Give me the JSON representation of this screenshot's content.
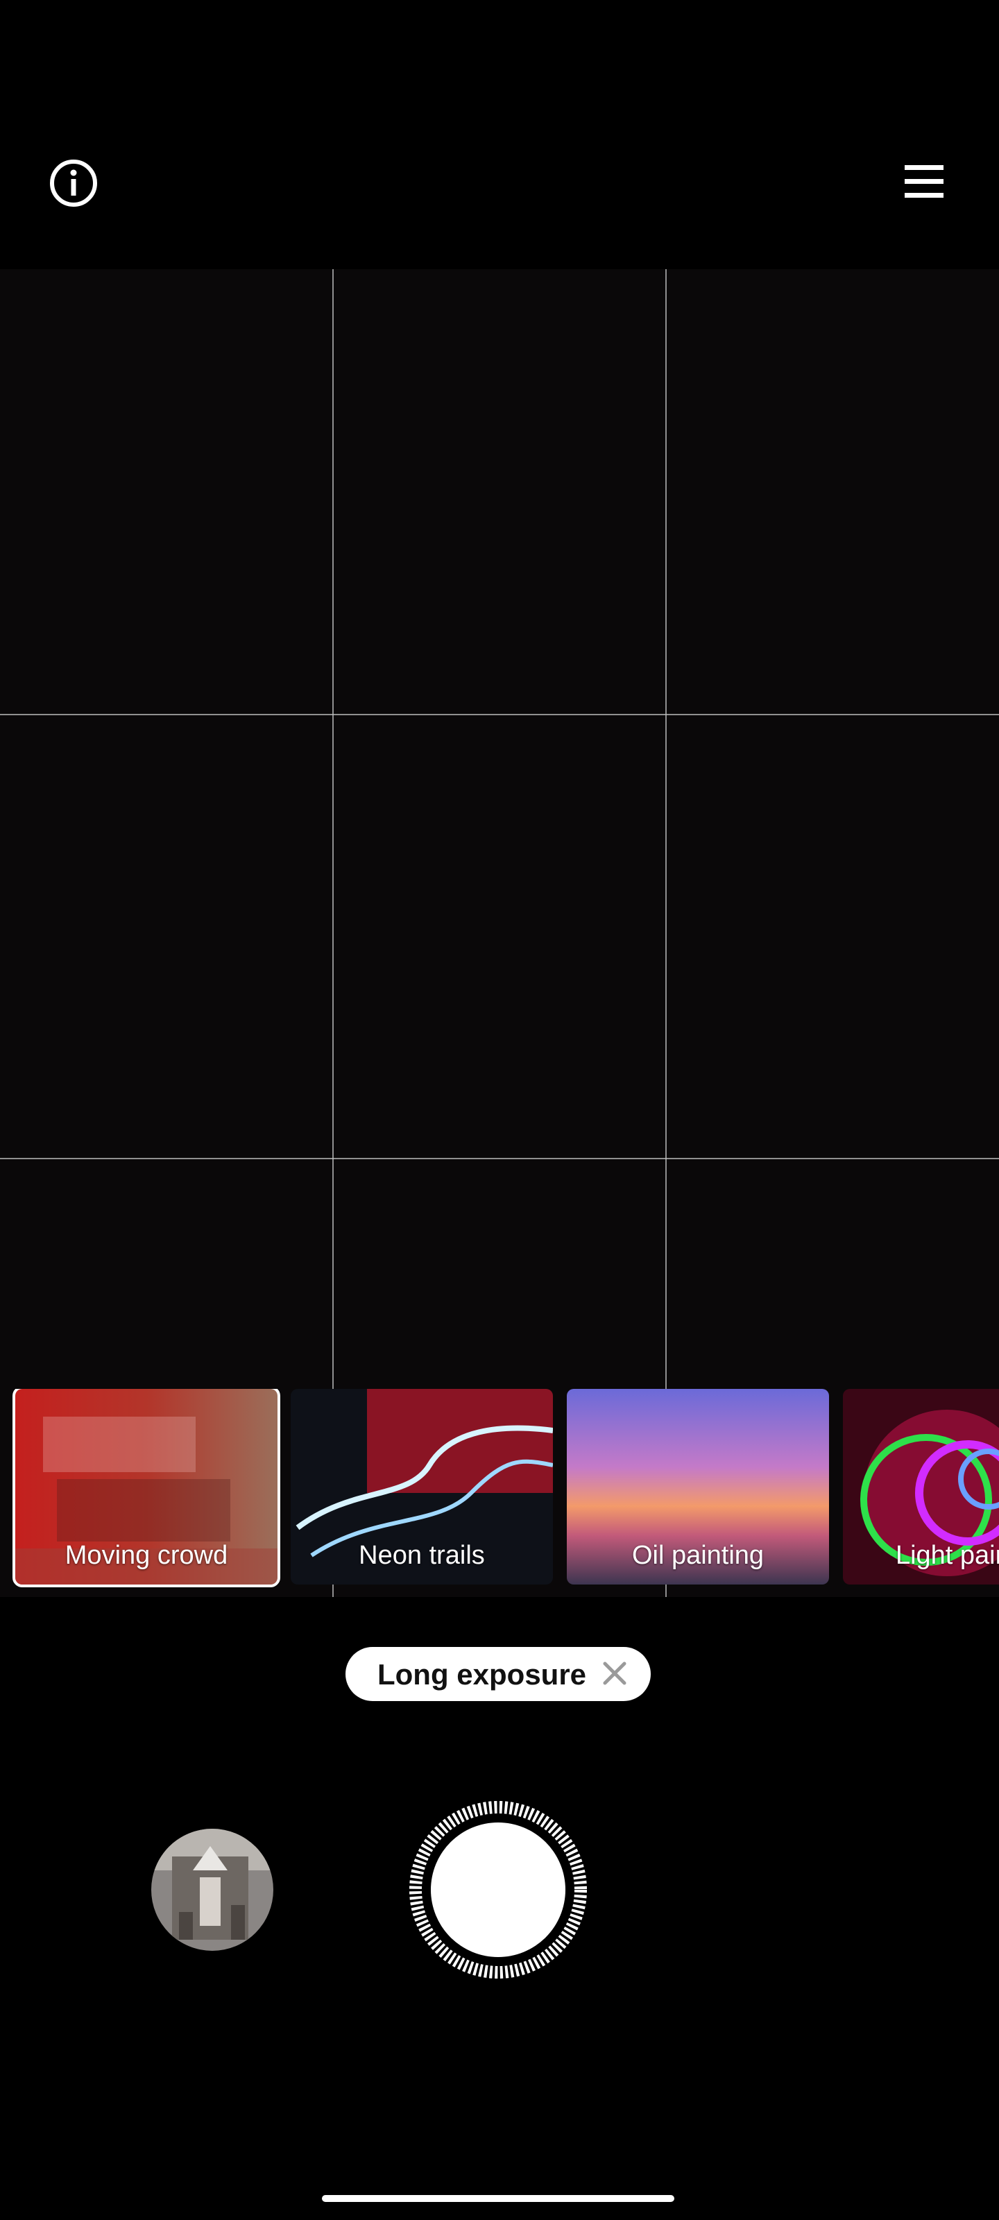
{
  "header": {
    "info_icon": "info-icon",
    "menu_icon": "hamburger-menu-icon"
  },
  "viewfinder": {
    "grid": "3x3"
  },
  "filters": {
    "items": [
      {
        "label": "Moving crowd",
        "selected": true
      },
      {
        "label": "Neon trails",
        "selected": false
      },
      {
        "label": "Oil painting",
        "selected": false
      },
      {
        "label": "Light painting",
        "selected": false
      }
    ]
  },
  "mode_chip": {
    "label": "Long exposure",
    "close_icon": "close-icon"
  },
  "controls": {
    "gallery_icon": "gallery-thumbnail",
    "shutter_icon": "shutter-button"
  },
  "colors": {
    "background": "#000000",
    "accent": "#ffffff"
  }
}
